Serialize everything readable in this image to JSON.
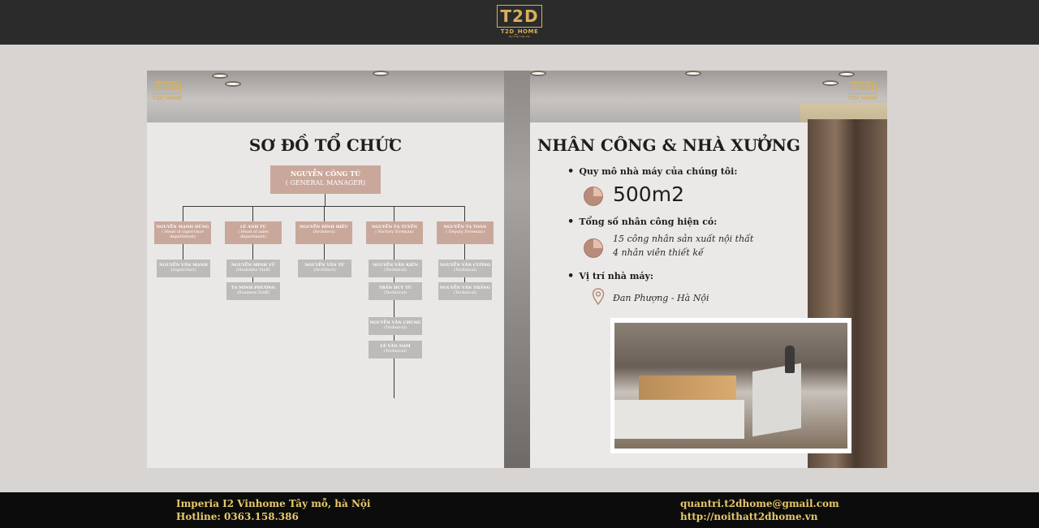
{
  "header": {
    "logo_mark": "T2D",
    "logo_name": "T2D_HOME",
    "logo_tagline": "Nội Thất Hiện Đại"
  },
  "slide": {
    "corner_logo_mark": "T2D",
    "corner_logo_name": "T2D_HOME",
    "left_panel": {
      "title": "SƠ ĐỒ TỔ CHỨC",
      "manager": {
        "name": "NGUYỄN CÔNG TÚ",
        "role": "( GENERAL MANAGER)"
      },
      "departments": [
        {
          "name": "NGUYỄN MẠNH DŨNG",
          "role": "( Head of supervisor department)",
          "staff": [
            {
              "name": "NGUYỄN VĂN MẠNH",
              "role": "(Supervisor)"
            }
          ]
        },
        {
          "name": "LÊ ANH TÚ",
          "role": "( Head of sales department)",
          "staff": [
            {
              "name": "NGUYỄN MINH VŨ",
              "role": "(Hostlinhe Staff)"
            },
            {
              "name": "TẠ MINH PHƯƠNG",
              "role": "(Business Staff)"
            }
          ]
        },
        {
          "name": "NGUYỄN ĐÌNH HIẾU",
          "role": "(Architect)",
          "staff": [
            {
              "name": "NGUYỄN VĂN TÚ",
              "role": "(Architect)"
            }
          ]
        },
        {
          "name": "NGUYỄN TẠ TUYỀN",
          "role": "( Factory foreman)",
          "staff": [
            {
              "name": "NGUYỄN VĂN KIÊN",
              "role": "(Technical)"
            },
            {
              "name": "TRẦN DUY TÚ",
              "role": "(Technical)"
            },
            {
              "name": "NGUYỄN VĂN CHUNG",
              "role": "(Technical)"
            },
            {
              "name": "LÊ VĂN NAM",
              "role": "(Technical)"
            }
          ]
        },
        {
          "name": "NGUYỄN TẠ TOÀN",
          "role": "( Deputy Foreman)",
          "staff": [
            {
              "name": "NGUYỄN VĂN CƯỜNG",
              "role": "(Technical)"
            },
            {
              "name": "NGUYỄN VĂN THẮNG",
              "role": "(Technical)"
            }
          ]
        }
      ]
    },
    "right_panel": {
      "title": "NHÂN CÔNG & NHÀ XƯỞNG",
      "bullet1": "Quy mô nhà máy của chúng tôi:",
      "value1": "500m2",
      "bullet2": "Tổng số nhân công hiện có:",
      "workers_line1": "15 công nhân sản xuất nội thất",
      "workers_line2": "4 nhân viên thiết kế",
      "bullet3": "Vị trí nhà máy:",
      "location": "Đan Phượng - Hà Nội",
      "icons": {
        "pie": "pie-chart-icon",
        "pin": "location-pin-icon"
      }
    }
  },
  "footer": {
    "address": "Imperia I2 Vinhome Tây mỗ, hà Nội",
    "hotline": "Hotline: 0363.158.386",
    "email": "quantri.t2dhome@gmail.com",
    "website": "http://noithatt2dhome.vn"
  },
  "colors": {
    "accent_gold": "#e8c96a",
    "node_rose": "#c9a89b",
    "node_gray": "#bdbbba",
    "topbar": "#2b2b2b"
  }
}
